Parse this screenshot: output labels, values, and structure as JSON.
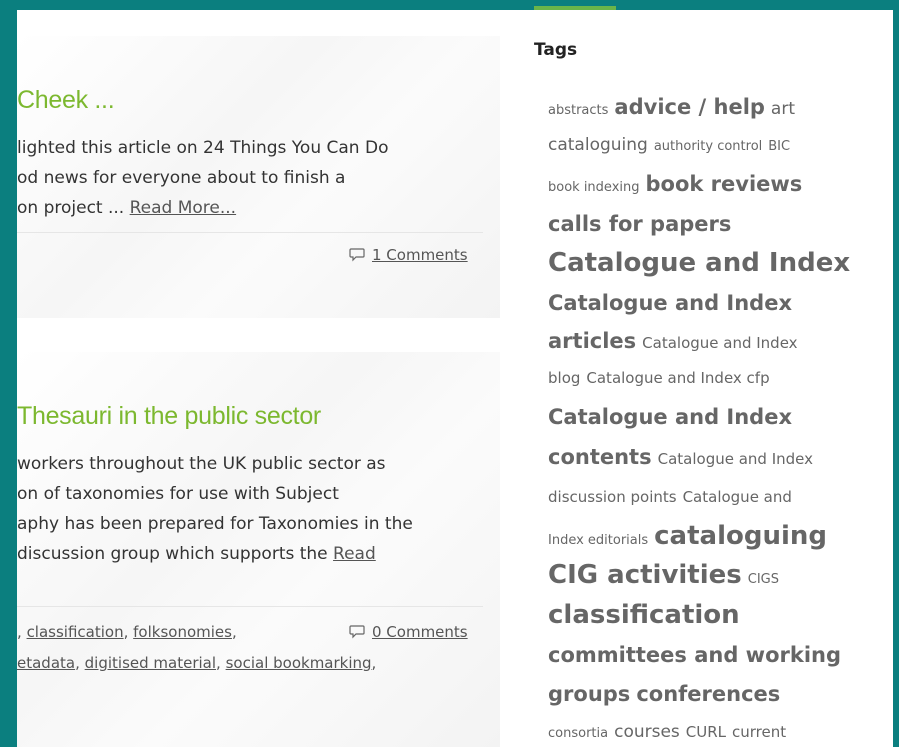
{
  "posts": [
    {
      "title": "Cheek ...",
      "excerpt_lines": [
        "lighted this article on 24 Things You Can Do",
        "od news for everyone about to finish a",
        "on project ... "
      ],
      "read_more": "Read More...",
      "comments": "1 Comments"
    },
    {
      "title": "Thesauri in the public sector",
      "excerpt_lines": [
        "workers throughout the UK public sector as",
        "on of taxonomies for use with Subject",
        "aphy has been prepared for Taxonomies in the",
        "discussion group which supports the "
      ],
      "read_more": "Read",
      "comments": "0 Comments",
      "tags_line1": [
        ",",
        "classification",
        ",",
        "folksonomies",
        ","
      ],
      "tags_line2": [
        "etadata",
        ",",
        "digitised material",
        ",",
        "social bookmarking",
        ","
      ]
    }
  ],
  "sidebar": {
    "heading": "Tags",
    "tags": [
      {
        "label": "abstracts",
        "size": "s1"
      },
      {
        "label": "advice / help",
        "size": "s4"
      },
      {
        "label": "art",
        "size": "s3"
      },
      {
        "label": "cataloguing",
        "size": "s3"
      },
      {
        "label": "authority control",
        "size": "s1"
      },
      {
        "label": "BIC",
        "size": "s1"
      },
      {
        "label": "book indexing",
        "size": "s1"
      },
      {
        "label": "book reviews",
        "size": "s4"
      },
      {
        "label": "calls for papers",
        "size": "s4"
      },
      {
        "label": "Catalogue and Index",
        "size": "s5"
      },
      {
        "label": "Catalogue and Index",
        "size": "s4"
      },
      {
        "label": "articles",
        "size": "s4"
      },
      {
        "label": "Catalogue and Index",
        "size": "s2"
      },
      {
        "label": "blog",
        "size": "s2"
      },
      {
        "label": "Catalogue and Index cfp",
        "size": "s2"
      },
      {
        "label": "Catalogue and Index",
        "size": "s4"
      },
      {
        "label": "contents",
        "size": "s4"
      },
      {
        "label": "Catalogue and Index",
        "size": "s2"
      },
      {
        "label": "discussion points",
        "size": "s2"
      },
      {
        "label": "Catalogue and",
        "size": "s2"
      },
      {
        "label": "Index editorials",
        "size": "s1"
      },
      {
        "label": "cataloguing",
        "size": "s5"
      },
      {
        "label": "CIG activities",
        "size": "s5"
      },
      {
        "label": "CIGS",
        "size": "s1"
      },
      {
        "label": "classification",
        "size": "s5"
      },
      {
        "label": "committees and working",
        "size": "s4"
      },
      {
        "label": "groups",
        "size": "s4"
      },
      {
        "label": "conferences",
        "size": "s4"
      },
      {
        "label": "consortia",
        "size": "s1"
      },
      {
        "label": "courses",
        "size": "s3"
      },
      {
        "label": "CURL",
        "size": "s2"
      },
      {
        "label": "current",
        "size": "s2"
      }
    ]
  },
  "colors": {
    "frame": "#0b7f7f",
    "title_green": "#7cb82f",
    "tab_accent": "#6ab54a"
  }
}
